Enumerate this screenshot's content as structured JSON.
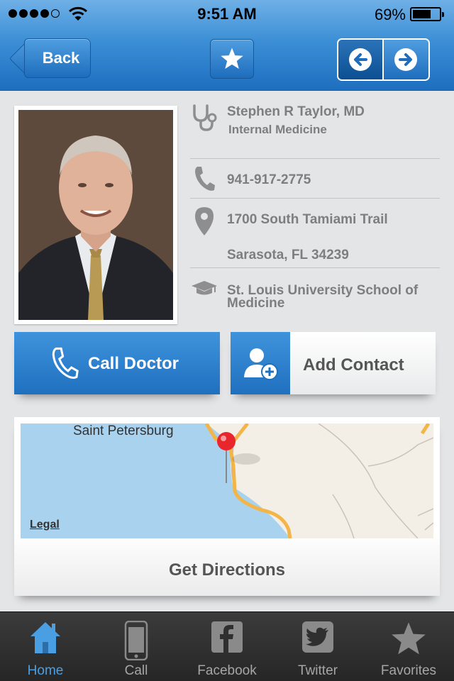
{
  "status_bar": {
    "time": "9:51 AM",
    "battery": "69%",
    "battery_level": 0.69
  },
  "nav": {
    "back_label": "Back",
    "favorite_icon": "star-icon",
    "prev_icon": "arrow-left-icon",
    "next_icon": "arrow-right-icon"
  },
  "doctor": {
    "name": "Stephen R Taylor, MD",
    "specialty": "Internal Medicine",
    "phone": "941-917-2775",
    "address_line1": "1700 South Tamiami Trail",
    "address_line2": "Sarasota, FL 34239",
    "education": "St. Louis University School of Medicine"
  },
  "actions": {
    "call_label": "Call Doctor",
    "add_contact_label": "Add Contact"
  },
  "map": {
    "city_label": "Saint Petersburg",
    "legal_label": "Legal",
    "directions_label": "Get Directions"
  },
  "tabs": [
    {
      "label": "Home",
      "icon": "home-icon",
      "active": true
    },
    {
      "label": "Call",
      "icon": "phone-icon",
      "active": false
    },
    {
      "label": "Facebook",
      "icon": "facebook-icon",
      "active": false
    },
    {
      "label": "Twitter",
      "icon": "twitter-icon",
      "active": false
    },
    {
      "label": "Favorites",
      "icon": "star-icon",
      "active": false
    }
  ],
  "colors": {
    "accent": "#2d7fcc",
    "tab_active": "#4a9fe3",
    "text_gray": "#7e7e80"
  }
}
